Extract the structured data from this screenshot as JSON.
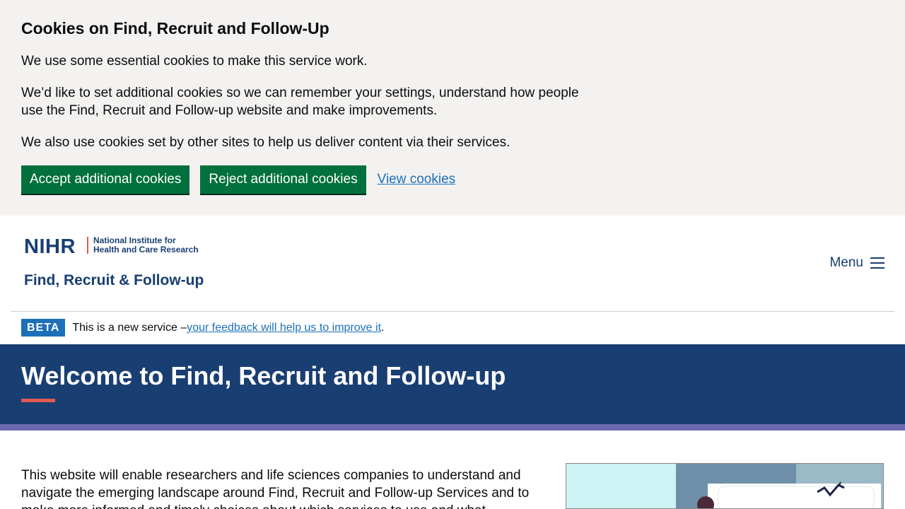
{
  "cookie_banner": {
    "heading": "Cookies on Find, Recruit and Follow-Up",
    "paragraphs": [
      "We use some essential cookies to make this service work.",
      "We’d like to set additional cookies so we can remember your settings, understand how people use the Find, Recruit and Follow-up website and make improvements.",
      "We also use cookies set by other sites to help us deliver content via their services."
    ],
    "accept_label": "Accept additional cookies",
    "reject_label": "Reject additional cookies",
    "view_label": "View cookies"
  },
  "header": {
    "logo_acronym": "NIHR",
    "logo_subtitle_line1": "National Institute for",
    "logo_subtitle_line2": "Health and Care Research",
    "service_name": "Find, Recruit & Follow-up",
    "menu_label": "Menu"
  },
  "beta": {
    "tag": "BETA",
    "text": "This is a new service – ",
    "link": "your feedback will help us to improve it",
    "end": "."
  },
  "hero": {
    "title": "Welcome to Find, Recruit and Follow-up"
  },
  "main": {
    "intro": "This website will enable researchers and life sciences companies to understand and navigate the emerging landscape around Find, Recruit and Follow-up Services and to make more informed and timely choices about which services to use and what"
  },
  "colors": {
    "brand_navy": "#193e72",
    "accent_red": "#e05b51",
    "stripe_purple": "#6c6ab0",
    "button_green": "#00703c",
    "link_blue": "#1d70b8"
  }
}
